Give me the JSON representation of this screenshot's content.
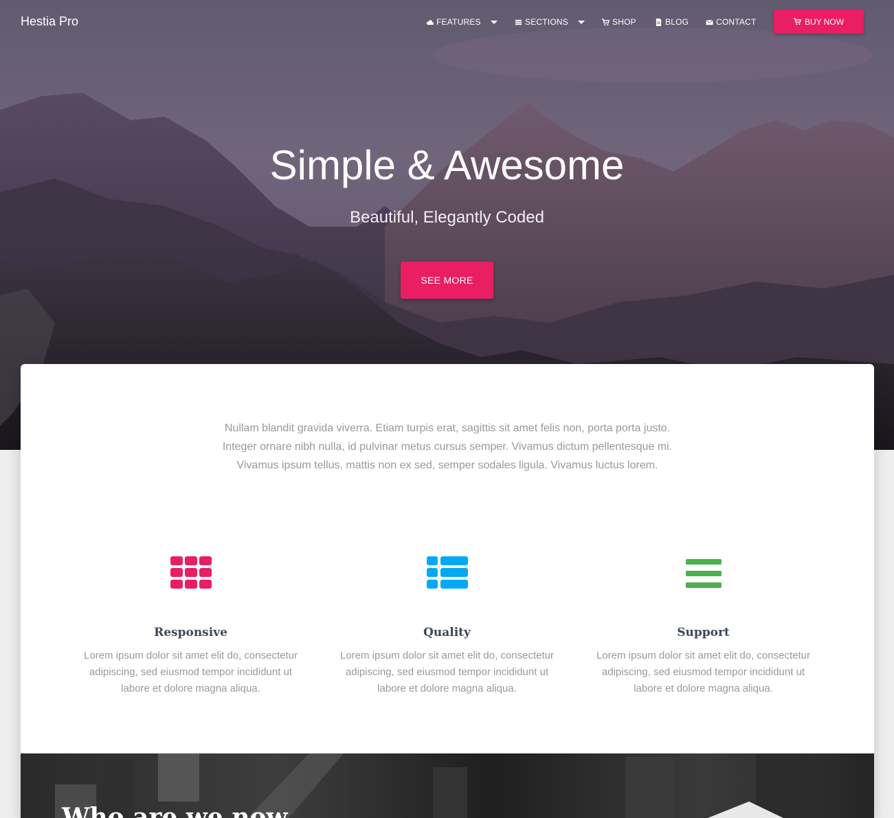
{
  "brand": "Hestia Pro",
  "nav": {
    "items": [
      {
        "label": "FEATURES",
        "icon": "cloud-icon"
      },
      {
        "label": "SECTIONS",
        "icon": "list-icon"
      },
      {
        "label": "SHOP",
        "icon": "cart-icon"
      },
      {
        "label": "BLOG",
        "icon": "document-icon"
      },
      {
        "label": "CONTACT",
        "icon": "envelope-icon"
      }
    ],
    "buy_label": "BUY NOW"
  },
  "hero": {
    "title": "Simple & Awesome",
    "subtitle": "Beautiful, Elegantly Coded",
    "cta": "SEE MORE"
  },
  "intro": {
    "lines": [
      "Nullam blandit gravida viverra. Etiam turpis erat, sagittis sit amet felis non, porta porta justo.",
      "Integer ornare nibh nulla, id pulvinar metus cursus semper. Vivamus dictum pellentesque mi.",
      "Vivamus ipsum tellus, mattis non ex sed, semper sodales ligula. Vivamus luctus lorem."
    ]
  },
  "features": [
    {
      "title": "Responsive",
      "icon": "grid-icon",
      "color": "#e91e63",
      "lines": [
        "Lorem ipsum dolor sit amet elit do, consectetur",
        "adipiscing, sed eiusmod tempor incididunt ut",
        "labore et dolore magna aliqua."
      ]
    },
    {
      "title": "Quality",
      "icon": "list-view-icon",
      "color": "#03a9f4",
      "lines": [
        "Lorem ipsum dolor sit amet elit do, consectetur",
        "adipiscing, sed eiusmod tempor incididunt ut",
        "labore et dolore magna aliqua."
      ]
    },
    {
      "title": "Support",
      "icon": "hamburger-icon",
      "color": "#4caf50",
      "lines": [
        "Lorem ipsum dolor sit amet elit do, consectetur",
        "adipiscing, sed eiusmod tempor incididunt ut",
        "labore et dolore magna aliqua."
      ]
    }
  ],
  "about": {
    "title": "Who are we now"
  },
  "colors": {
    "accent": "#e91e63"
  }
}
